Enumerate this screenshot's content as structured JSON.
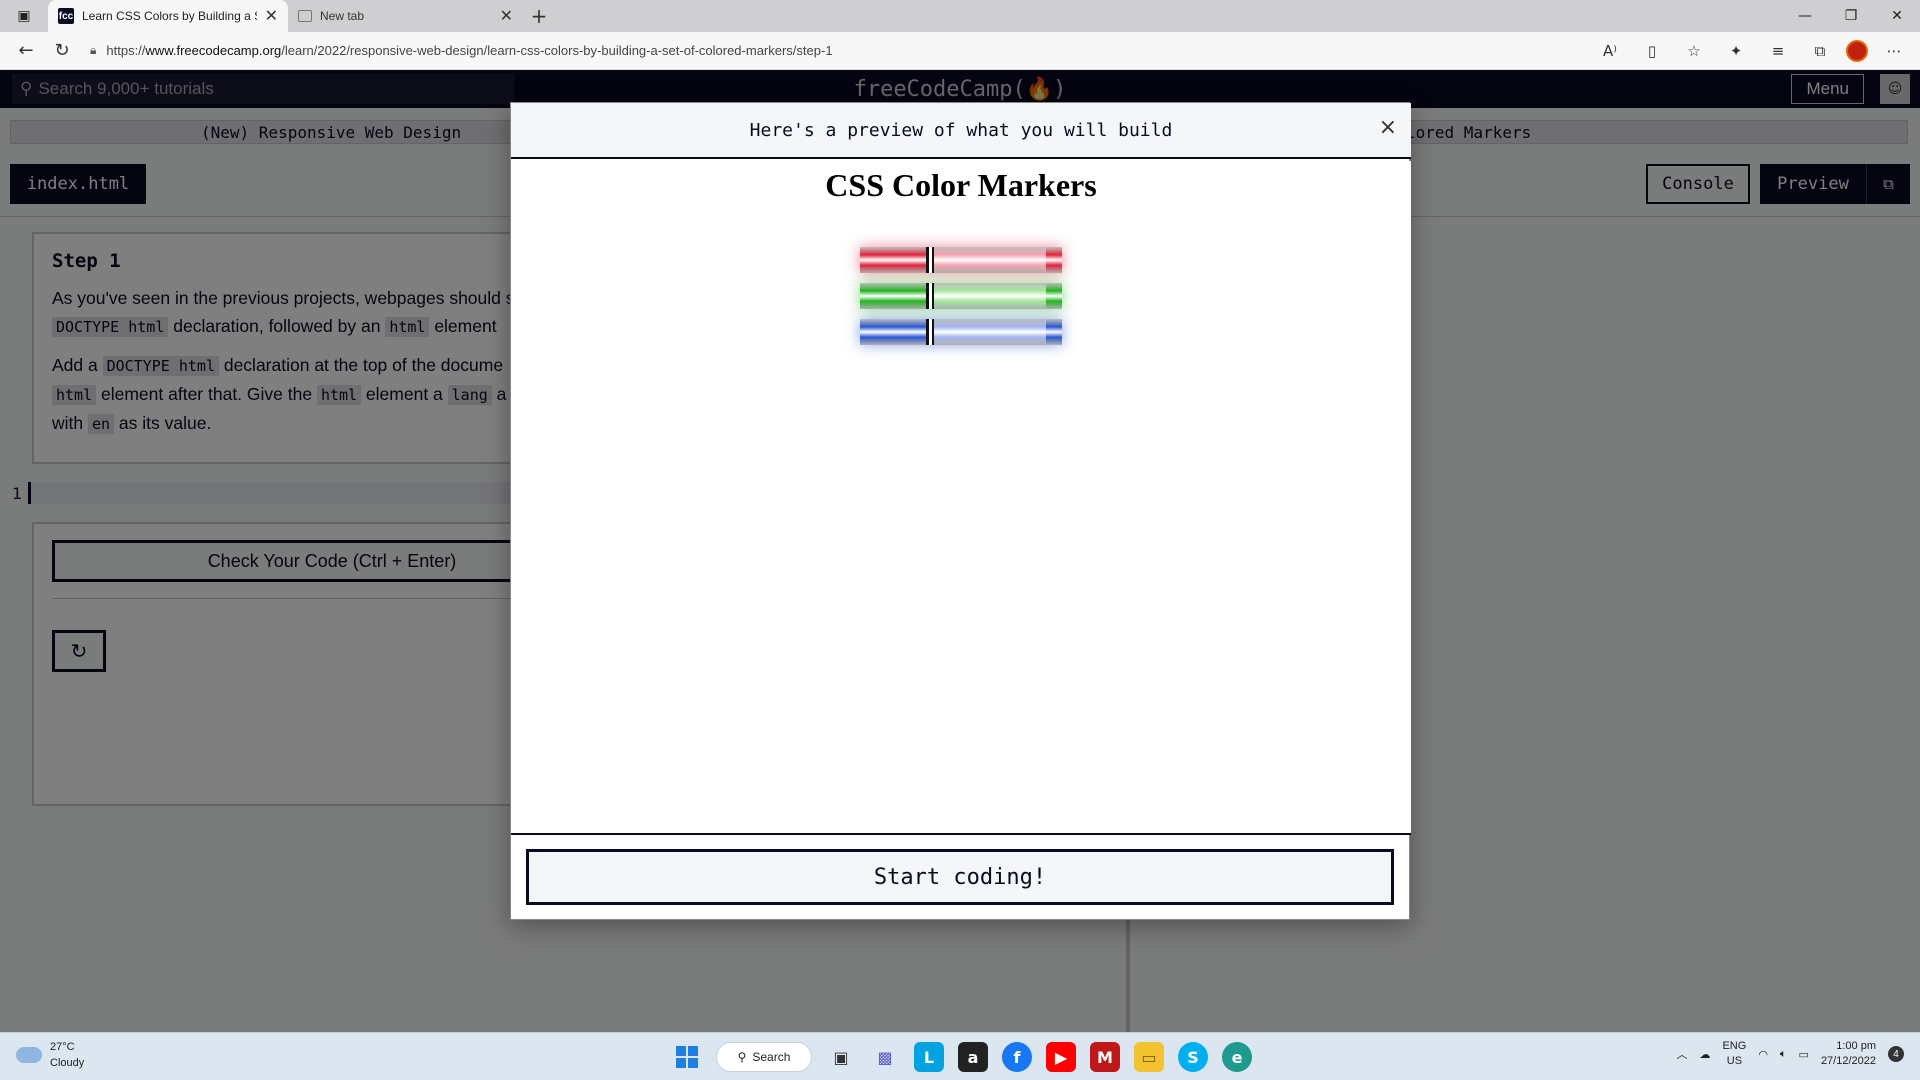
{
  "browser": {
    "tabs": [
      {
        "title": "Learn CSS Colors by Building a S",
        "active": true,
        "favicon": "freecodecamp-icon"
      },
      {
        "title": "New tab",
        "active": false,
        "favicon": "new-tab-icon"
      }
    ],
    "url_prefix": "https://",
    "url_domain": "www.freecodecamp.org",
    "url_path": "/learn/2022/responsive-web-design/learn-css-colors-by-building-a-set-of-colored-markers/step-1"
  },
  "fcc": {
    "search_placeholder": "Search 9,000+ tutorials",
    "logo": "freeCodeCamp(🔥)",
    "menu_label": "Menu",
    "breadcrumb_left": "(New) Responsive Web Design",
    "breadcrumb_right": "lored Markers",
    "file_tab": "index.html",
    "console_label": "Console",
    "preview_label": "Preview",
    "step_title": "Step 1",
    "p1_a": "As you've seen in the previous projects, webpages should s",
    "p1_code1": "DOCTYPE html",
    "p1_b": " declaration, followed by an ",
    "p1_code2": "html",
    "p1_c": " element",
    "p2_a": "Add a ",
    "p2_code1": "DOCTYPE html",
    "p2_b": " declaration at the top of the docume",
    "p2_code2": "html",
    "p2_c": " element after that. Give the ",
    "p2_code3": "html",
    "p2_d": " element a ",
    "p2_code4": "lang",
    "p2_e": " a",
    "p2_f": "with ",
    "p2_code5": "en",
    "p2_g": " as its value.",
    "line_number": "1",
    "check_label": "Check Your Code (Ctrl + Enter)"
  },
  "modal": {
    "title": "Here's a preview of what you will build",
    "close_glyph": "×",
    "preview_heading": "CSS Color Markers",
    "markers": [
      {
        "name": "red",
        "tip": "#e0243c",
        "sleeve": "#f4a3b0"
      },
      {
        "name": "green",
        "tip": "#22b51f",
        "sleeve": "#a6e79e"
      },
      {
        "name": "blue",
        "tip": "#2a58d4",
        "sleeve": "#a4b5f2"
      }
    ],
    "start_label": "Start coding!"
  },
  "taskbar": {
    "temperature": "27°C",
    "weather": "Cloudy",
    "search_label": "Search",
    "lang_line1": "ENG",
    "lang_line2": "US",
    "time": "1:00 pm",
    "date": "27/12/2022",
    "notifications": "4"
  }
}
